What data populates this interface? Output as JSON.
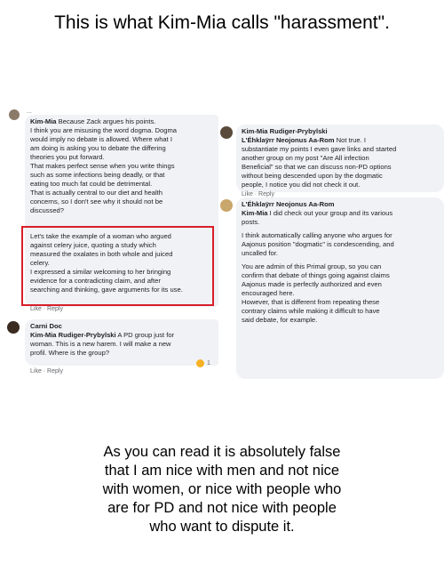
{
  "headline": "This is what Kim-Mia calls \"harassment\".",
  "left_column": {
    "truncated_author": "...",
    "comment1": {
      "author": "Kim-Mia",
      "lines": [
        "Because Zack argues his points.",
        "I think you are misusing the word dogma. Dogma",
        "would imply no debate is allowed. Where what I",
        "am doing is asking you to debate the differing",
        "theories you put forward.",
        "That makes perfect sense when you write things",
        "such as some infections being deadly, or that",
        "eating too much fat could be detrimental.",
        "That is actually central to our diet and health",
        "concerns, so I don't see why it should not be",
        "discussed?"
      ],
      "highlighted_lines": [
        "Let's take the example of a woman who argued",
        "against celery juice, quoting a study which",
        "measured the oxalates in both whole and juiced",
        "celery.",
        "I expressed a similar welcoming to her bringing",
        "evidence for a contradicting claim, and after",
        "searching and thinking, gave arguments for its use."
      ],
      "actions": "Like · Reply"
    },
    "comment2": {
      "author": "Carni Doc",
      "mention": "Kim-Mia Rudiger-Prybylski",
      "lines": [
        "A PD group just for",
        "woman. This is a new harem. I will make a new",
        "profil. Where is the group?"
      ],
      "actions": "Like · Reply",
      "reaction_count": "1"
    }
  },
  "right_column": {
    "comment1": {
      "author": "Kim-Mia Rudiger-Prybylski",
      "mention": "L'Éhklaÿrr Neojonus Aa-Rom",
      "lines": [
        "Not true. I",
        "substantiate my points I even gave links and started",
        "another group on my post \"Are All infection",
        "Beneficial\" so that we can discuss non-PD options",
        "without being descended upon by the dogmatic",
        "people, I notice you did not check it out."
      ],
      "actions": "Like · Reply"
    },
    "comment2": {
      "author": "L'Éhklaÿrr Neojonus Aa-Rom",
      "mention": "Kim-Mia",
      "para1": [
        "I did check out your group and its various",
        "posts."
      ],
      "para2": [
        "I think automatically calling anyone who argues for",
        "Aajonus position \"dogmatic\" is condescending, and",
        "uncalled for."
      ],
      "para3": [
        "You are admin of this Primal group, so you can",
        "confirm that debate of things going against claims",
        "Aajonus made is perfectly authorized and even",
        "encouraged here.",
        "However, that is different from repeating these",
        "contrary claims while making it difficult to have",
        "said debate, for example."
      ]
    }
  },
  "footer_lines": [
    "As you can read it is absolutely false",
    "that I am nice with men and not nice",
    "with women, or nice with people who",
    "are for PD and not nice with people",
    "who want to dispute it."
  ],
  "colors": {
    "highlight_border": "#d81e2a",
    "bubble_bg": "#f0f2f5",
    "meta_text": "#65676b"
  }
}
